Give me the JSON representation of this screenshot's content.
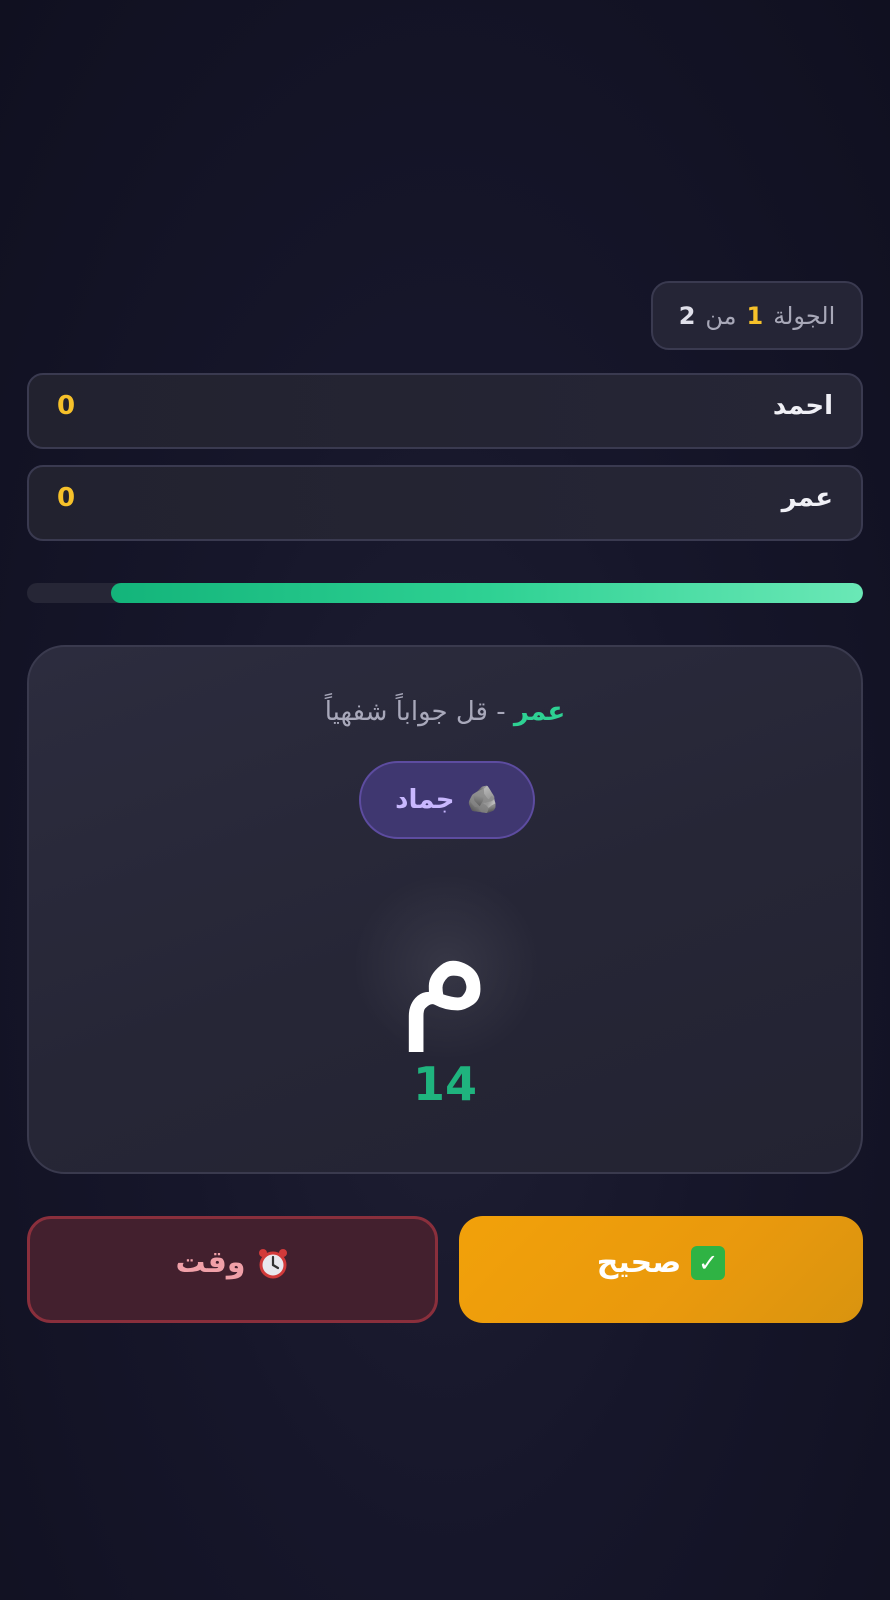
{
  "round": {
    "label": "الجولة",
    "current": "1",
    "of_word": "من",
    "total": "2"
  },
  "players": [
    {
      "name": "احمد",
      "score": "0"
    },
    {
      "name": "عمر",
      "score": "0"
    }
  ],
  "timer": {
    "remaining_fraction": 0.9
  },
  "card": {
    "active_player": "عمر",
    "instruction": " - قل جواباً شفهياً",
    "category_icon": "rock-icon",
    "category_label": "جماد",
    "letter": "م",
    "countdown": "14"
  },
  "buttons": {
    "correct_label": "صحيح",
    "timeout_label": "وقت"
  },
  "colors": {
    "accent_green": "#2ed193",
    "accent_yellow": "#f6c12a",
    "correct_button": "#f2a10a",
    "timeout_button": "#43202e",
    "category_pill": "#3f3770"
  }
}
